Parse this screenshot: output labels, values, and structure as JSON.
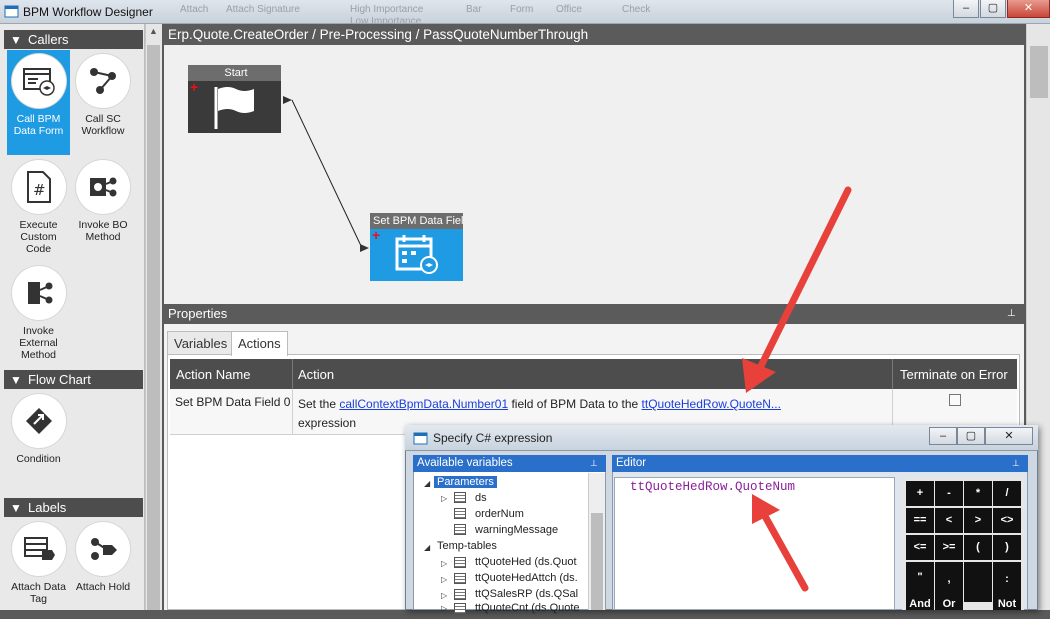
{
  "window": {
    "title": "BPM Workflow Designer",
    "buttons": [
      "–",
      "▢",
      "✕"
    ]
  },
  "ribbon_ghost": [
    "Attach",
    "Attach Signature",
    "High Importance",
    "Low Importance",
    "Bar",
    "Form",
    "Office",
    "Check"
  ],
  "sidebar": {
    "groups": [
      {
        "label": "Callers"
      },
      {
        "label": "Flow Chart"
      },
      {
        "label": "Labels"
      }
    ],
    "tools": [
      {
        "label": "Call BPM Data Form"
      },
      {
        "label": "Call SC Workflow"
      },
      {
        "label": "Execute Custom Code"
      },
      {
        "label": "Invoke BO Method"
      },
      {
        "label": "Invoke External Method"
      },
      {
        "label": "Condition"
      },
      {
        "label": "Attach Data Tag"
      },
      {
        "label": "Attach Hold"
      }
    ]
  },
  "canvas": {
    "breadcrumb": "Erp.Quote.CreateOrder / Pre-Processing / PassQuoteNumberThrough",
    "nodes": [
      {
        "label": "Start"
      },
      {
        "label": "Set BPM Data Field"
      }
    ]
  },
  "properties": {
    "title": "Properties",
    "tabs": [
      {
        "label": "Variables"
      },
      {
        "label": "Actions"
      }
    ],
    "columns": [
      "Action Name",
      "Action",
      "Terminate on Error"
    ],
    "row": {
      "name": "Set BPM Data Field 0",
      "text_1": "Set the ",
      "link_1": "callContextBpmData.Number01",
      "text_2": " field of BPM Data to the ",
      "link_2": "ttQuoteHedRow.QuoteN...",
      "text_3": "expression",
      "terminate_checked": false
    }
  },
  "dialog": {
    "title": "Specify C# expression",
    "variables_header": "Available variables",
    "tree": [
      {
        "label": "Parameters"
      },
      {
        "label": "ds"
      },
      {
        "label": "orderNum"
      },
      {
        "label": "warningMessage"
      },
      {
        "label": "Temp-tables"
      },
      {
        "label": "ttQuoteHed (ds.Quot"
      },
      {
        "label": "ttQuoteHedAttch (ds."
      },
      {
        "label": "ttQSalesRP (ds.QSal"
      },
      {
        "label": "ttQuoteCnt (ds.Quote"
      }
    ],
    "editor_header": "Editor",
    "expression": "ttQuoteHedRow.QuoteNum",
    "operators": [
      "+",
      "-",
      "*",
      "/",
      "==",
      "<",
      ">",
      "<>",
      "<=",
      ">=",
      "(",
      ")",
      "\"",
      ",",
      ":",
      "",
      "And",
      "Or",
      "Not"
    ]
  },
  "colors": {
    "accent": "#1e9be3",
    "annotation_arrow": "#e8403a"
  }
}
